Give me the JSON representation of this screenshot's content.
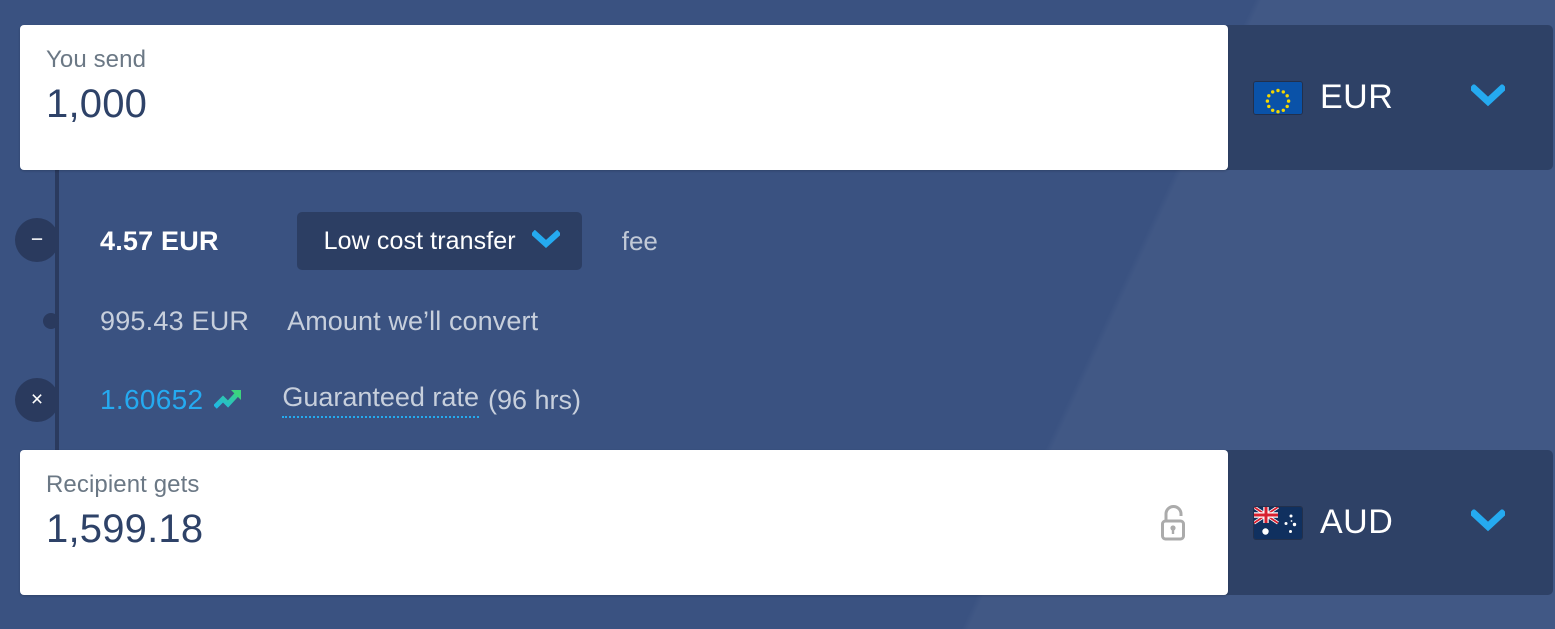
{
  "theme": {
    "page_background": "#3A5281",
    "panel_background": "#2E4166",
    "accent_cyan": "#25AAF0",
    "rail_color": "#2A3A5E",
    "muted_text": "#C7CFDC",
    "value_text": "#2E4268"
  },
  "send": {
    "label": "You send",
    "value": "1,000",
    "currency_code": "EUR",
    "flag": "eu-flag-icon",
    "chevron": "chevron-down-icon"
  },
  "fee": {
    "operator": "−",
    "operator_name": "minus-operator",
    "amount": "4.57 EUR",
    "option_label": "Low cost transfer",
    "option_chevron": "chevron-down-icon",
    "suffix": "fee"
  },
  "convert": {
    "operator_name": "dot-node",
    "amount": "995.43 EUR",
    "label": "Amount we’ll convert"
  },
  "rate": {
    "operator": "×",
    "operator_name": "multiply-operator",
    "value": "1.60652",
    "trend_icon": "trend-up-icon",
    "label": "Guaranteed rate",
    "duration": "(96 hrs)"
  },
  "receive": {
    "label": "Recipient gets",
    "value": "1,599.18",
    "currency_code": "AUD",
    "flag": "au-flag-icon",
    "lock_icon": "unlocked-padlock-icon",
    "chevron": "chevron-down-icon"
  }
}
